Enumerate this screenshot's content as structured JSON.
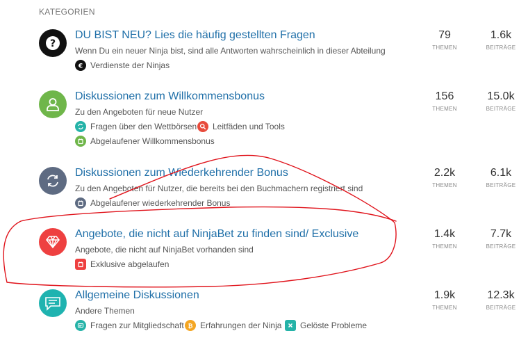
{
  "section_title": "KATEGORIEN",
  "colors": {
    "link": "#1f6fa8",
    "annotation": "#e0131b"
  },
  "stat_labels": {
    "topics": "THEMEN",
    "posts": "BEITRÄGE"
  },
  "categories": [
    {
      "title": "DU BIST NEU? Lies die häufig gestellten Fragen",
      "description": "Wenn Du ein neuer Ninja bist, sind alle Antworten wahrscheinlich in dieser Abteilung",
      "icon": "question-icon",
      "icon_color": "#111111",
      "topics": "79",
      "posts": "1.6k",
      "subcategories": [
        {
          "label": "Verdienste der Ninjas",
          "icon": "euro-icon",
          "color": "#111111"
        }
      ]
    },
    {
      "title": "Diskussionen zum Willkommensbonus",
      "description": "Zu den Angeboten für neue Nutzer",
      "icon": "user-icon",
      "icon_color": "#6fb64a",
      "topics": "156",
      "posts": "15.0k",
      "subcategories": [
        {
          "label": "Fragen über den Wettbörsen",
          "icon": "refresh-icon",
          "color": "#25b3a8"
        },
        {
          "label": "Leitfäden und Tools",
          "icon": "search-icon",
          "color": "#e84b3c"
        },
        {
          "label": "Abgelaufener Willkommensbonus",
          "icon": "calendar-icon",
          "color": "#6fb64a"
        }
      ]
    },
    {
      "title": "Diskussionen zum Wiederkehrender Bonus",
      "description": "Zu den Angeboten für Nutzer, die bereits bei den Buchmachern registriert sind",
      "icon": "refresh-icon",
      "icon_color": "#5e6b82",
      "topics": "2.2k",
      "posts": "6.1k",
      "subcategories": [
        {
          "label": "Abgelaufener wiederkehrender Bonus",
          "icon": "calendar-icon",
          "color": "#5e6b82"
        }
      ]
    },
    {
      "title": "Angebote, die nicht auf NinjaBet zu finden sind/ Exclusive",
      "description": "Angebote, die nicht auf NinjaBet vorhanden sind",
      "icon": "diamond-icon",
      "icon_color": "#ee4040",
      "topics": "1.4k",
      "posts": "7.7k",
      "subcategories": [
        {
          "label": "Exklusive abgelaufen",
          "icon": "calendar-icon",
          "color": "#ee4040"
        }
      ]
    },
    {
      "title": "Allgemeine Diskussionen",
      "description": "Andere Themen",
      "icon": "chat-icon",
      "icon_color": "#1fb3b0",
      "topics": "1.9k",
      "posts": "12.3k",
      "subcategories": [
        {
          "label": "Fragen zur Mitgliedschaft",
          "icon": "card-icon",
          "color": "#25b3a8"
        },
        {
          "label": "Erfahrungen der Ninja",
          "icon": "bitcoin-icon",
          "color": "#f4a623"
        },
        {
          "label": "Gelöste Probleme",
          "icon": "close-icon",
          "color": "#25b3a8"
        }
      ]
    }
  ]
}
